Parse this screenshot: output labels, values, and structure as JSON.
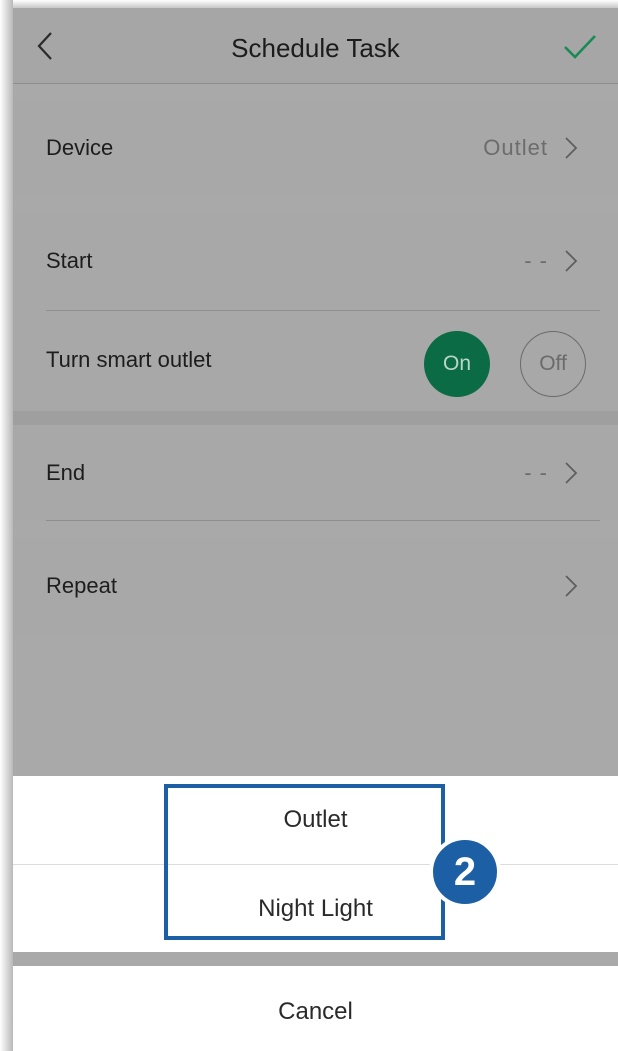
{
  "nav": {
    "title": "Schedule Task",
    "back_icon": "chevron-left-icon",
    "confirm_icon": "checkmark-icon",
    "confirm_color": "#1a8a55"
  },
  "rows": {
    "device": {
      "label": "Device",
      "value": "Outlet"
    },
    "start": {
      "label": "Start",
      "value": "- -"
    },
    "turn": {
      "label": "Turn smart outlet",
      "on_label": "On",
      "off_label": "Off",
      "selected": "On",
      "on_color": "#0b6b45"
    },
    "end": {
      "label": "End",
      "value": "- -"
    },
    "repeat": {
      "label": "Repeat",
      "value": ""
    }
  },
  "action_sheet": {
    "options": [
      "Outlet",
      "Night Light"
    ],
    "cancel_label": "Cancel"
  },
  "annotation": {
    "step_number": "2",
    "color": "#1d5fa4"
  }
}
